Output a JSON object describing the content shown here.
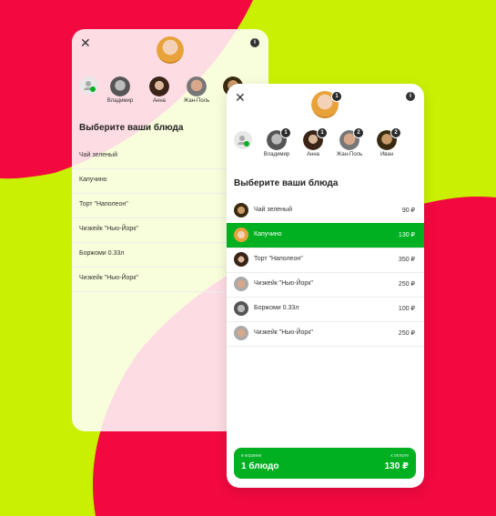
{
  "colors": {
    "red": "#f2093f",
    "lime": "#c9f000",
    "green": "#00b020"
  },
  "back_card": {
    "people": [
      {
        "name": "Владимир"
      },
      {
        "name": "Анна"
      },
      {
        "name": "Жан-Поль"
      },
      {
        "name": ""
      }
    ],
    "title": "Выберите ваши блюда",
    "items": [
      "Чай зеленый",
      "Капучино",
      "Торт \"Наполеон\"",
      "Чизкейк \"Нью-Йорк\"",
      "Боржоми 0.33л",
      "Чизкейк \"Нью-Йорк\""
    ]
  },
  "front_card": {
    "main_avatar_badge": "1",
    "people": [
      {
        "name": "Владимир",
        "badge": "1"
      },
      {
        "name": "Анна",
        "badge": "1"
      },
      {
        "name": "Жан-Поль",
        "badge": "2"
      },
      {
        "name": "Иван",
        "badge": "2"
      }
    ],
    "title": "Выберите ваши блюда",
    "items": [
      {
        "name": "Чай зеленый",
        "price": "90 ₽"
      },
      {
        "name": "Капучино",
        "price": "130 ₽",
        "selected": true
      },
      {
        "name": "Торт \"Наполеон\"",
        "price": "350 ₽"
      },
      {
        "name": "Чизкейк \"Нью-Йорк\"",
        "price": "250 ₽"
      },
      {
        "name": "Боржоми 0.33л",
        "price": "100 ₽"
      },
      {
        "name": "Чизкейк \"Нью-Йорк\"",
        "price": "250 ₽"
      }
    ],
    "cart": {
      "left_caption": "в корзине",
      "left_value": "1 блюдо",
      "right_caption": "к оплате",
      "right_value": "130 ₽"
    }
  }
}
